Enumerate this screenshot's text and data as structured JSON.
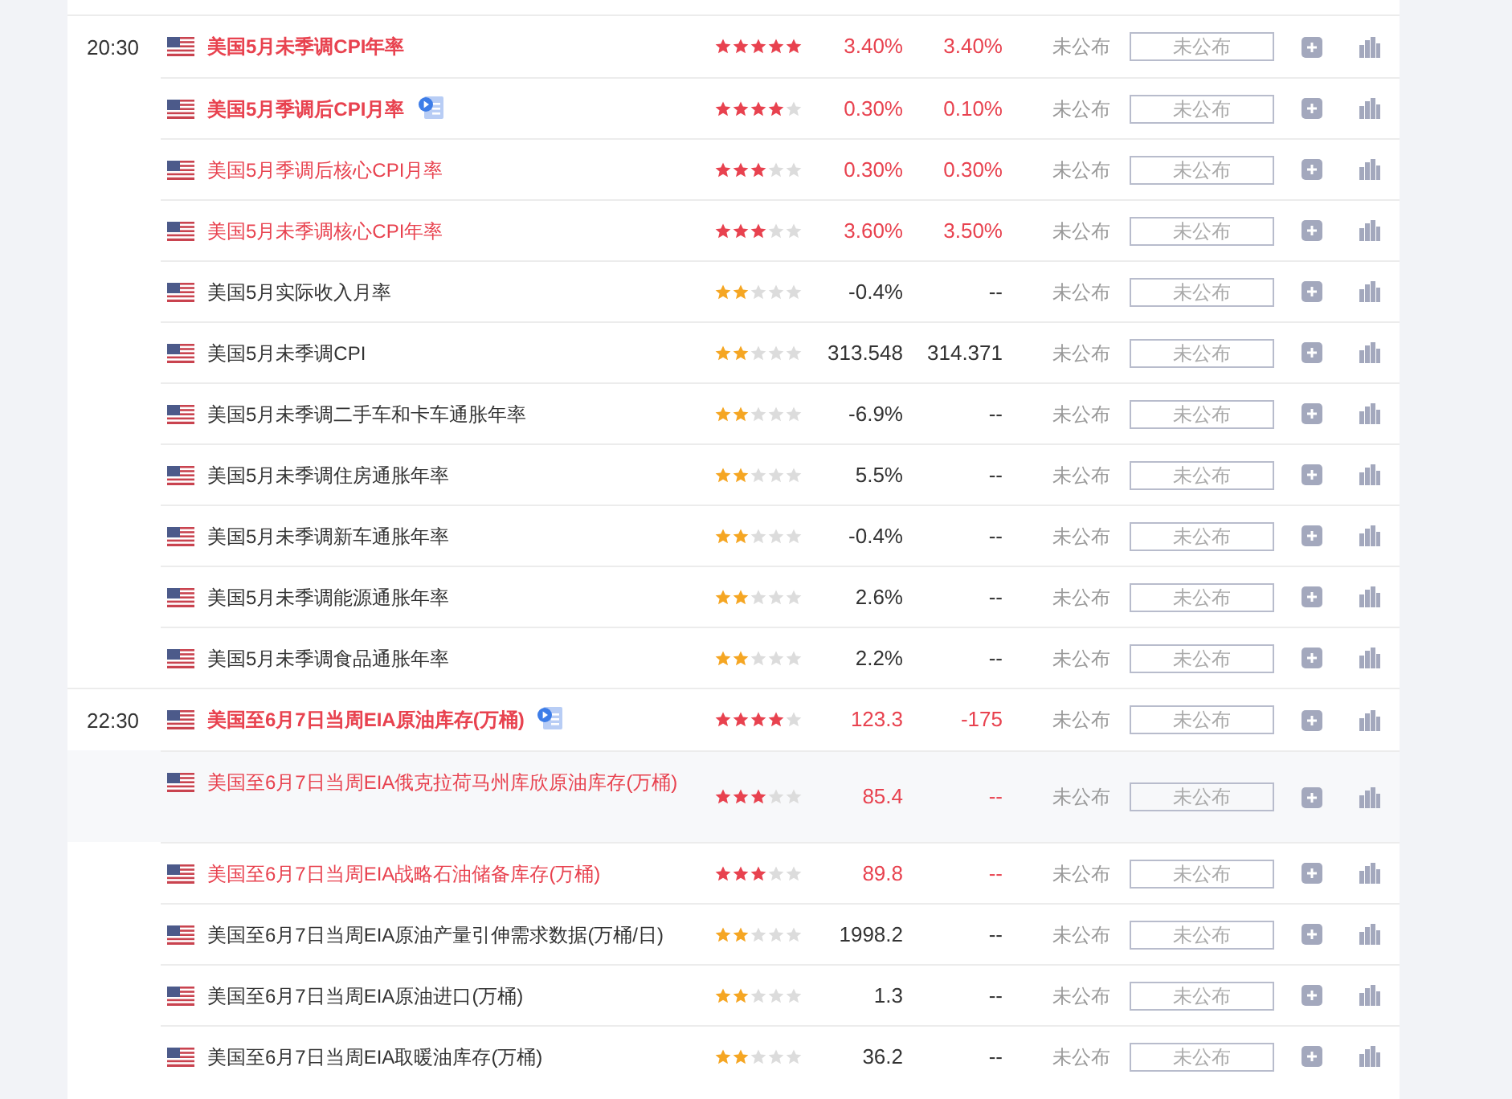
{
  "groups": [
    {
      "time": "20:30",
      "events": [
        {
          "name": "美国5月未季调CPI年率",
          "bold": true,
          "highlight": true,
          "video": false,
          "hovered": false,
          "stars": 5,
          "previous": "3.40%",
          "forecast": "3.40%",
          "actual": "未公布",
          "placeholder": "未公布"
        },
        {
          "name": "美国5月季调后CPI月率",
          "bold": true,
          "highlight": true,
          "video": true,
          "hovered": false,
          "stars": 4,
          "previous": "0.30%",
          "forecast": "0.10%",
          "actual": "未公布",
          "placeholder": "未公布"
        },
        {
          "name": "美国5月季调后核心CPI月率",
          "bold": false,
          "highlight": true,
          "video": false,
          "hovered": false,
          "stars": 3,
          "previous": "0.30%",
          "forecast": "0.30%",
          "actual": "未公布",
          "placeholder": "未公布"
        },
        {
          "name": "美国5月未季调核心CPI年率",
          "bold": false,
          "highlight": true,
          "video": false,
          "hovered": false,
          "stars": 3,
          "previous": "3.60%",
          "forecast": "3.50%",
          "actual": "未公布",
          "placeholder": "未公布"
        },
        {
          "name": "美国5月实际收入月率",
          "bold": false,
          "highlight": false,
          "video": false,
          "hovered": false,
          "stars": 2,
          "previous": "-0.4%",
          "forecast": "--",
          "actual": "未公布",
          "placeholder": "未公布"
        },
        {
          "name": "美国5月未季调CPI",
          "bold": false,
          "highlight": false,
          "video": false,
          "hovered": false,
          "stars": 2,
          "previous": "313.548",
          "forecast": "314.371",
          "actual": "未公布",
          "placeholder": "未公布"
        },
        {
          "name": "美国5月未季调二手车和卡车通胀年率",
          "bold": false,
          "highlight": false,
          "video": false,
          "hovered": false,
          "stars": 2,
          "previous": "-6.9%",
          "forecast": "--",
          "actual": "未公布",
          "placeholder": "未公布"
        },
        {
          "name": "美国5月未季调住房通胀年率",
          "bold": false,
          "highlight": false,
          "video": false,
          "hovered": false,
          "stars": 2,
          "previous": "5.5%",
          "forecast": "--",
          "actual": "未公布",
          "placeholder": "未公布"
        },
        {
          "name": "美国5月未季调新车通胀年率",
          "bold": false,
          "highlight": false,
          "video": false,
          "hovered": false,
          "stars": 2,
          "previous": "-0.4%",
          "forecast": "--",
          "actual": "未公布",
          "placeholder": "未公布"
        },
        {
          "name": "美国5月未季调能源通胀年率",
          "bold": false,
          "highlight": false,
          "video": false,
          "hovered": false,
          "stars": 2,
          "previous": "2.6%",
          "forecast": "--",
          "actual": "未公布",
          "placeholder": "未公布"
        },
        {
          "name": "美国5月未季调食品通胀年率",
          "bold": false,
          "highlight": false,
          "video": false,
          "hovered": false,
          "stars": 2,
          "previous": "2.2%",
          "forecast": "--",
          "actual": "未公布",
          "placeholder": "未公布"
        }
      ]
    },
    {
      "time": "22:30",
      "events": [
        {
          "name": "美国至6月7日当周EIA原油库存(万桶)",
          "bold": true,
          "highlight": true,
          "video": true,
          "hovered": false,
          "stars": 4,
          "previous": "123.3",
          "forecast": "-175",
          "actual": "未公布",
          "placeholder": "未公布"
        },
        {
          "name": "美国至6月7日当周EIA俄克拉荷马州库欣原油库存(万桶)",
          "bold": false,
          "highlight": true,
          "video": false,
          "hovered": true,
          "stars": 3,
          "previous": "85.4",
          "forecast": "--",
          "actual": "未公布",
          "placeholder": "未公布"
        },
        {
          "name": "美国至6月7日当周EIA战略石油储备库存(万桶)",
          "bold": false,
          "highlight": true,
          "video": false,
          "hovered": false,
          "stars": 3,
          "previous": "89.8",
          "forecast": "--",
          "actual": "未公布",
          "placeholder": "未公布"
        },
        {
          "name": "美国至6月7日当周EIA原油产量引伸需求数据(万桶/日)",
          "bold": false,
          "highlight": false,
          "video": false,
          "hovered": false,
          "stars": 2,
          "previous": "1998.2",
          "forecast": "--",
          "actual": "未公布",
          "placeholder": "未公布"
        },
        {
          "name": "美国至6月7日当周EIA原油进口(万桶)",
          "bold": false,
          "highlight": false,
          "video": false,
          "hovered": false,
          "stars": 2,
          "previous": "1.3",
          "forecast": "--",
          "actual": "未公布",
          "placeholder": "未公布"
        },
        {
          "name": "美国至6月7日当周EIA取暖油库存(万桶)",
          "bold": false,
          "highlight": false,
          "video": false,
          "hovered": false,
          "stars": 2,
          "previous": "36.2",
          "forecast": "--",
          "actual": "未公布",
          "placeholder": "未公布"
        }
      ]
    }
  ]
}
